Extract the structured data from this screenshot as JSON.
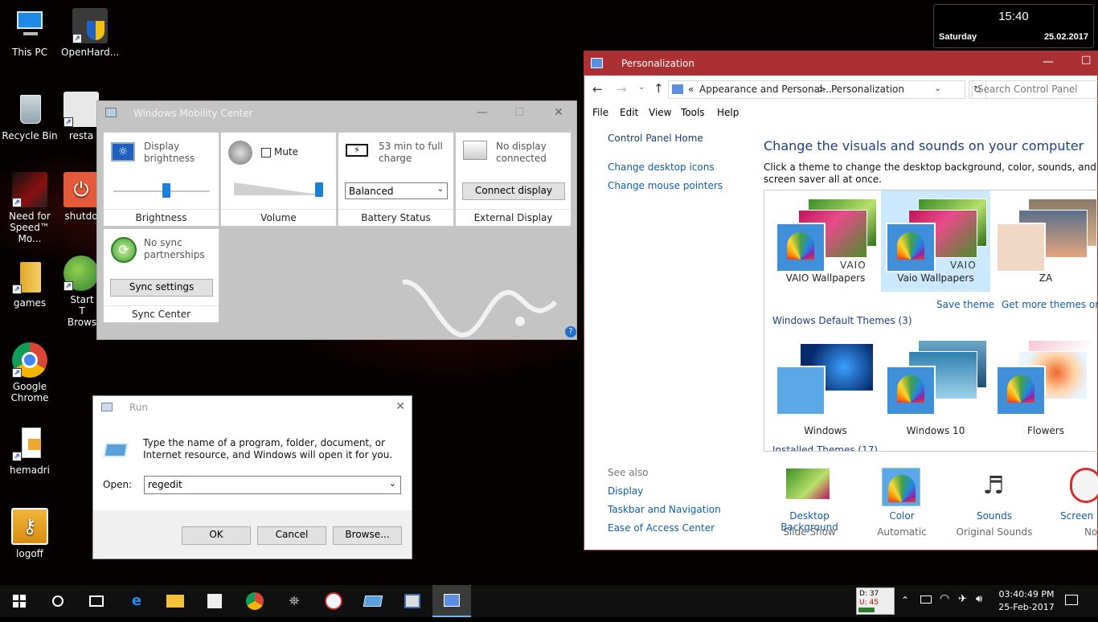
{
  "desktop": {
    "icons": [
      {
        "label": "This PC"
      },
      {
        "label": "OpenHard..."
      },
      {
        "label": "Recycle Bin"
      },
      {
        "label": "resta"
      },
      {
        "label": "Need for Speed™ Mo..."
      },
      {
        "label": "shutdo"
      },
      {
        "label": "games"
      },
      {
        "label": "Start T Brows"
      },
      {
        "label": "Google Chrome"
      },
      {
        "label": "hemadri"
      },
      {
        "label": "logoff"
      }
    ]
  },
  "clock_widget": {
    "time": "15:40",
    "day": "Saturday",
    "date": "25.02.2017"
  },
  "mobility": {
    "title": "Windows Mobility Center",
    "brightness": {
      "desc": "Display brightness",
      "label": "Brightness",
      "level": 0.55
    },
    "volume": {
      "mute_label": "Mute",
      "label": "Volume",
      "level": 0.95
    },
    "battery": {
      "desc": "53 min to full charge",
      "plan": "Balanced",
      "label": "Battery Status"
    },
    "display": {
      "desc": "No display connected",
      "button": "Connect display",
      "label": "External Display"
    },
    "sync": {
      "desc": "No sync partnerships",
      "button": "Sync settings",
      "label": "Sync Center"
    }
  },
  "run": {
    "title": "Run",
    "description": "Type the name of a program, folder, document, or Internet resource, and Windows will open it for you.",
    "open_label": "Open:",
    "open_value": "regedit",
    "ok": "OK",
    "cancel": "Cancel",
    "browse": "Browse..."
  },
  "personalization": {
    "title": "Personalization",
    "breadcrumb": {
      "prefix": "«",
      "part1": "Appearance and Personal...",
      "sep": ">",
      "part2": "Personalization"
    },
    "search_placeholder": "Search Control Panel",
    "menu": [
      "File",
      "Edit",
      "View",
      "Tools",
      "Help"
    ],
    "sidebar": {
      "home": "Control Panel Home",
      "links": [
        "Change desktop icons",
        "Change mouse pointers"
      ],
      "see_also_title": "See also",
      "see_also": [
        "Display",
        "Taskbar and Navigation",
        "Ease of Access Center"
      ]
    },
    "heading": "Change the visuals and sounds on your computer",
    "intro": "Click a theme to change the desktop background, color, sounds, and screen saver all at once.",
    "my_themes": [
      "VAIO Wallpapers",
      "Vaio Wallpapers",
      "ZA"
    ],
    "save_theme": "Save theme",
    "get_more": "Get more themes online",
    "default_group": "Windows Default Themes (3)",
    "default_themes": [
      "Windows",
      "Windows 10",
      "Flowers"
    ],
    "installed_group": "Installed Themes (17)",
    "bottom": [
      {
        "title": "Desktop Background",
        "sub": "Slide Show"
      },
      {
        "title": "Color",
        "sub": "Automatic"
      },
      {
        "title": "Sounds",
        "sub": "Original Sounds"
      },
      {
        "title": "Screen Saver",
        "sub": "None"
      }
    ],
    "vaio_text": "VAIO"
  },
  "taskbar": {
    "meter": {
      "d": "D: 37",
      "u": "U: 45"
    },
    "time": "03:40:49 PM",
    "date": "25-Feb-2017"
  },
  "colors": {
    "accent": "#aa3033",
    "link": "#0f5ea8",
    "taskbar": "#101010"
  }
}
